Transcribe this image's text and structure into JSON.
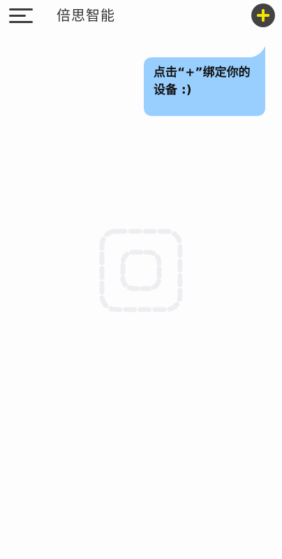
{
  "header": {
    "title": "倍思智能",
    "menu_icon": "hamburger-menu-icon",
    "add_icon": "plus-circle-icon"
  },
  "hint": {
    "message": "点击“+”绑定你的设备 :)"
  },
  "empty_state": {
    "icon": "dashed-camera-placeholder-icon"
  },
  "colors": {
    "background": "#fdfdfd",
    "bubble": "#99cfff",
    "add_button_bg": "#434343",
    "add_button_plus": "#f5e600",
    "placeholder": "#eeeef2"
  }
}
